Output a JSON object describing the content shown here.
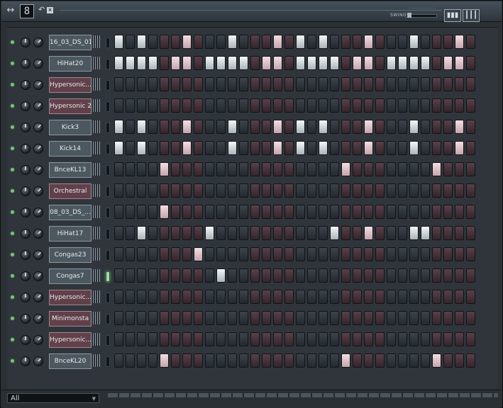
{
  "toolbar": {
    "move_icon": "double-arrow",
    "pattern_number": "8",
    "undo_icon": "undo-arrow",
    "close_icon": "x",
    "swing_label": "SWING",
    "swing_level": 0.05,
    "graph_mode_icon": "bars-graph",
    "keyboard_mode_icon": "piano-keys"
  },
  "channels": [
    {
      "name": "16_03_DS_01",
      "color": "grey",
      "steps": [
        1,
        0,
        1,
        0,
        0,
        0,
        1,
        0,
        0,
        0,
        1,
        0,
        0,
        0,
        1,
        0,
        1,
        0,
        1,
        0,
        0,
        0,
        1,
        0,
        0,
        0,
        1,
        0,
        0,
        0,
        1,
        0
      ]
    },
    {
      "name": "HiHat20",
      "color": "grey",
      "steps": [
        1,
        1,
        1,
        1,
        0,
        1,
        1,
        0,
        1,
        1,
        1,
        1,
        0,
        1,
        1,
        0,
        1,
        1,
        1,
        1,
        0,
        1,
        1,
        0,
        1,
        1,
        1,
        1,
        0,
        1,
        1,
        0
      ]
    },
    {
      "name": "Hypersonic...",
      "color": "red",
      "steps": [
        0,
        0,
        0,
        0,
        0,
        0,
        0,
        0,
        0,
        0,
        0,
        0,
        0,
        0,
        0,
        0,
        0,
        0,
        0,
        0,
        0,
        0,
        0,
        0,
        0,
        0,
        0,
        0,
        0,
        0,
        0,
        0
      ]
    },
    {
      "name": "Hypersonic 2",
      "color": "red",
      "steps": [
        0,
        0,
        0,
        0,
        0,
        0,
        0,
        0,
        0,
        0,
        0,
        0,
        0,
        0,
        0,
        0,
        0,
        0,
        0,
        0,
        0,
        0,
        0,
        0,
        0,
        0,
        0,
        0,
        0,
        0,
        0,
        0
      ]
    },
    {
      "name": "Kick3",
      "color": "grey",
      "steps": [
        1,
        0,
        1,
        0,
        0,
        0,
        1,
        0,
        0,
        0,
        1,
        0,
        0,
        0,
        1,
        0,
        1,
        0,
        1,
        0,
        0,
        0,
        1,
        0,
        0,
        0,
        1,
        0,
        0,
        0,
        1,
        0
      ]
    },
    {
      "name": "Kick14",
      "color": "grey",
      "steps": [
        1,
        0,
        1,
        0,
        0,
        0,
        1,
        0,
        0,
        0,
        1,
        0,
        0,
        0,
        1,
        0,
        1,
        0,
        1,
        0,
        0,
        0,
        1,
        0,
        0,
        0,
        1,
        0,
        0,
        0,
        1,
        0
      ]
    },
    {
      "name": "BnceKL13",
      "color": "grey",
      "steps": [
        0,
        0,
        0,
        0,
        1,
        0,
        0,
        0,
        0,
        0,
        0,
        0,
        0,
        0,
        0,
        0,
        0,
        0,
        0,
        0,
        1,
        0,
        0,
        0,
        0,
        0,
        0,
        0,
        1,
        0,
        0,
        0
      ]
    },
    {
      "name": "Orchestral",
      "color": "red",
      "steps": [
        0,
        0,
        0,
        0,
        0,
        0,
        0,
        0,
        0,
        0,
        0,
        0,
        0,
        0,
        0,
        0,
        0,
        0,
        0,
        0,
        0,
        0,
        0,
        0,
        0,
        0,
        0,
        0,
        0,
        0,
        0,
        0
      ]
    },
    {
      "name": "08_03_DS_...",
      "color": "grey",
      "steps": [
        0,
        0,
        0,
        0,
        1,
        0,
        0,
        0,
        0,
        0,
        0,
        0,
        0,
        0,
        0,
        0,
        0,
        0,
        0,
        0,
        0,
        0,
        0,
        0,
        0,
        0,
        0,
        0,
        0,
        0,
        0,
        0
      ]
    },
    {
      "name": "HiHat17",
      "color": "grey",
      "steps": [
        0,
        0,
        1,
        0,
        0,
        0,
        0,
        0,
        1,
        0,
        0,
        0,
        0,
        0,
        0,
        0,
        0,
        0,
        0,
        1,
        0,
        0,
        1,
        0,
        0,
        0,
        1,
        1,
        0,
        0,
        0,
        0
      ]
    },
    {
      "name": "Congas23",
      "color": "grey",
      "steps": [
        0,
        0,
        0,
        0,
        0,
        0,
        0,
        1,
        0,
        0,
        0,
        0,
        0,
        0,
        0,
        0,
        0,
        0,
        0,
        0,
        0,
        0,
        0,
        0,
        0,
        0,
        0,
        0,
        0,
        0,
        0,
        0
      ]
    },
    {
      "name": "Congas7",
      "color": "grey",
      "steps": [
        0,
        0,
        0,
        0,
        0,
        0,
        0,
        0,
        0,
        1,
        0,
        0,
        0,
        0,
        0,
        0,
        0,
        0,
        0,
        0,
        0,
        0,
        0,
        0,
        0,
        0,
        0,
        0,
        0,
        0,
        0,
        0
      ]
    },
    {
      "name": "Hypersonic...",
      "color": "red",
      "steps": [
        0,
        0,
        0,
        0,
        0,
        0,
        0,
        0,
        0,
        0,
        0,
        0,
        0,
        0,
        0,
        0,
        0,
        0,
        0,
        0,
        0,
        0,
        0,
        0,
        0,
        0,
        0,
        0,
        0,
        0,
        0,
        0
      ]
    },
    {
      "name": "Minimonsta",
      "color": "red",
      "steps": [
        0,
        0,
        0,
        0,
        0,
        0,
        0,
        0,
        0,
        0,
        0,
        0,
        0,
        0,
        0,
        0,
        0,
        0,
        0,
        0,
        0,
        0,
        0,
        0,
        0,
        0,
        0,
        0,
        0,
        0,
        0,
        0
      ]
    },
    {
      "name": "Hypersonic...",
      "color": "red",
      "steps": [
        0,
        0,
        0,
        0,
        0,
        0,
        0,
        0,
        0,
        0,
        0,
        0,
        0,
        0,
        0,
        0,
        0,
        0,
        0,
        0,
        0,
        0,
        0,
        0,
        0,
        0,
        0,
        0,
        0,
        0,
        0,
        0
      ]
    },
    {
      "name": "BnceKL20",
      "color": "grey",
      "steps": [
        0,
        0,
        0,
        0,
        1,
        0,
        0,
        0,
        0,
        0,
        0,
        0,
        0,
        0,
        0,
        0,
        0,
        0,
        0,
        0,
        1,
        0,
        0,
        0,
        0,
        0,
        0,
        0,
        1,
        0,
        0,
        0
      ]
    }
  ],
  "selected_channel_index": 11,
  "bottom": {
    "filter_value": "All",
    "dropdown_icon": "triangle-down"
  }
}
